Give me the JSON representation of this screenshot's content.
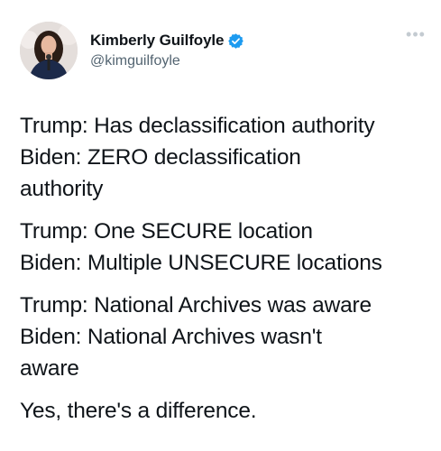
{
  "tweet": {
    "author": {
      "display_name": "Kimberly Guilfoyle",
      "handle": "@kimguilfoyle",
      "verified": true,
      "verified_color": "#1d9bf0"
    },
    "more_icon": "more-dots-icon",
    "paragraphs": [
      [
        "Trump: Has declassification authority",
        "Biden: ZERO declassification",
        "authority"
      ],
      [
        "Trump: One SECURE location",
        "Biden: Multiple UNSECURE locations"
      ],
      [
        "Trump: National Archives was aware",
        "Biden: National Archives wasn't",
        "aware"
      ],
      [
        "Yes, there's a difference."
      ]
    ]
  }
}
